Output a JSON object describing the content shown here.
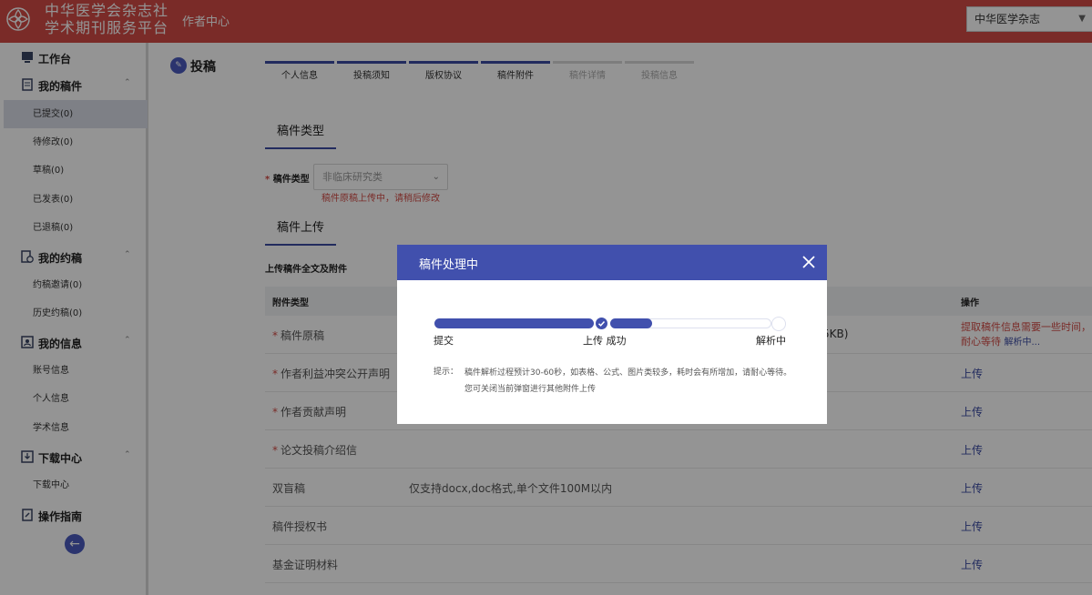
{
  "header": {
    "brand_line1": "中华医学会杂志社",
    "brand_line2": "学术期刊服务平台",
    "nav": "作者中心",
    "journal_select": "中华医学杂志"
  },
  "sidebar": {
    "workbench": "工作台",
    "my_manuscripts": {
      "label": "我的稿件",
      "items": [
        "已提交(0)",
        "待修改(0)",
        "草稿(0)",
        "已发表(0)",
        "已退稿(0)"
      ]
    },
    "my_invites": {
      "label": "我的约稿",
      "items": [
        "约稿邀请(0)",
        "历史约稿(0)"
      ]
    },
    "my_info": {
      "label": "我的信息",
      "items": [
        "账号信息",
        "个人信息",
        "学术信息"
      ]
    },
    "downloads": {
      "label": "下载中心",
      "items": [
        "下载中心"
      ]
    },
    "guide": "操作指南"
  },
  "main": {
    "page_title": "投稿",
    "steps": [
      {
        "label": "个人信息",
        "done": true
      },
      {
        "label": "投稿须知",
        "done": true
      },
      {
        "label": "版权协议",
        "done": true
      },
      {
        "label": "稿件附件",
        "done": true
      },
      {
        "label": "稿件详情",
        "done": false
      },
      {
        "label": "投稿信息",
        "done": false
      }
    ],
    "section_type": "稿件类型",
    "type_label": "稿件类型",
    "type_value": "非临床研究类",
    "type_hint": "稿件原稿上传中，请稍后修改",
    "section_upload": "稿件上传",
    "upload_label": "上传稿件全文及附件",
    "table": {
      "col_type": "附件类型",
      "col_action": "操作",
      "rows": [
        {
          "name": "稿件原稿",
          "required": true,
          "desc": "",
          "size": "5KB)",
          "action": "提取稿件信息需要一些时间，",
          "action2": "耐心等待",
          "action3": "解析中..."
        },
        {
          "name": "作者利益冲突公开声明",
          "required": true,
          "desc": "",
          "action": "上传"
        },
        {
          "name": "作者贡献声明",
          "required": true,
          "desc": "",
          "action": "上传"
        },
        {
          "name": "论文投稿介绍信",
          "required": true,
          "desc": "",
          "action": "上传"
        },
        {
          "name": "双盲稿",
          "required": false,
          "desc": "仅支持docx,doc格式,单个文件100M以内",
          "action": "上传"
        },
        {
          "name": "稿件授权书",
          "required": false,
          "desc": "",
          "action": "上传"
        },
        {
          "name": "基金证明材料",
          "required": false,
          "desc": "",
          "action": "上传"
        }
      ]
    }
  },
  "modal": {
    "title": "稿件处理中",
    "labels": {
      "submit": "提交",
      "uploaded": "上传 成功",
      "parsing": "解析中"
    },
    "progress": {
      "stage1_fraction": 1.0,
      "stage2_fraction": 0.26
    },
    "tip_label": "提示：",
    "tip_text": "稿件解析过程预计30-60秒，如表格、公式、图片类较多，耗时会有所增加，请耐心等待。您可关闭当前弹窗进行其他附件上传"
  },
  "colors": {
    "header_red": "#d24b45",
    "primary_blue": "#4150ad",
    "required_red": "#d24b45"
  }
}
